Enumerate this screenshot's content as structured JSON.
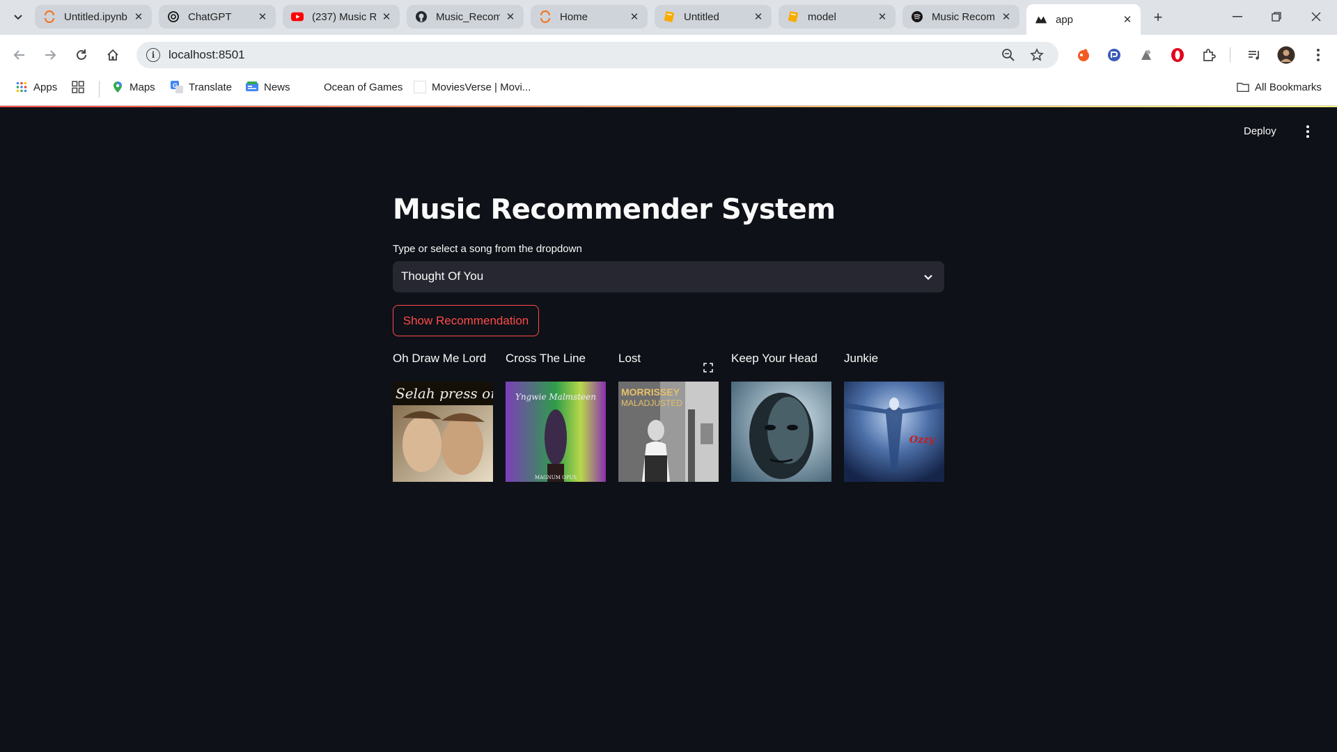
{
  "browser": {
    "tabs": [
      {
        "title": "Untitled.ipynb",
        "favicon": "jupyter-icon"
      },
      {
        "title": "ChatGPT",
        "favicon": "chatgpt-icon"
      },
      {
        "title": "(237) Music R",
        "favicon": "youtube-icon"
      },
      {
        "title": "Music_Recom",
        "favicon": "github-icon"
      },
      {
        "title": "Home",
        "favicon": "jupyter-icon"
      },
      {
        "title": "Untitled",
        "favicon": "colab-icon"
      },
      {
        "title": "model",
        "favicon": "colab-icon"
      },
      {
        "title": "Music Recom",
        "favicon": "spotify-icon"
      },
      {
        "title": "app",
        "favicon": "streamlit-icon",
        "active": true
      }
    ],
    "url": "localhost:8501",
    "bookmarks": [
      {
        "label": "Apps",
        "icon": "apps-grid-icon"
      },
      {
        "label": "Maps",
        "icon": "maps-icon"
      },
      {
        "label": "Translate",
        "icon": "translate-icon"
      },
      {
        "label": "News",
        "icon": "news-icon"
      },
      {
        "label": "Ocean of Games",
        "icon": ""
      },
      {
        "label": "MoviesVerse | Movi...",
        "icon": "page-icon"
      }
    ],
    "all_bookmarks_label": "All Bookmarks"
  },
  "app": {
    "deploy_label": "Deploy",
    "title": "Music Recommender System",
    "select_label": "Type or select a song from the dropdown",
    "selected_song": "Thought Of You",
    "button_label": "Show Recommendation",
    "recommendations": [
      {
        "title": "Oh Draw Me Lord",
        "cover_text": "Selah  press on"
      },
      {
        "title": "Cross The Line",
        "cover_text": "Yngwie Malmsteen",
        "cover_subtext": "MAGNUM OPUS"
      },
      {
        "title": "Lost",
        "cover_text": "MORRISSEY",
        "cover_subtext": "MALADJUSTED"
      },
      {
        "title": "Keep Your Head",
        "cover_text": ""
      },
      {
        "title": "Junkie",
        "cover_text": "Ozzy"
      }
    ]
  },
  "colors": {
    "accent": "#ff4b4b",
    "background": "#0e1117",
    "widget": "#262730",
    "text": "#fafafa"
  }
}
